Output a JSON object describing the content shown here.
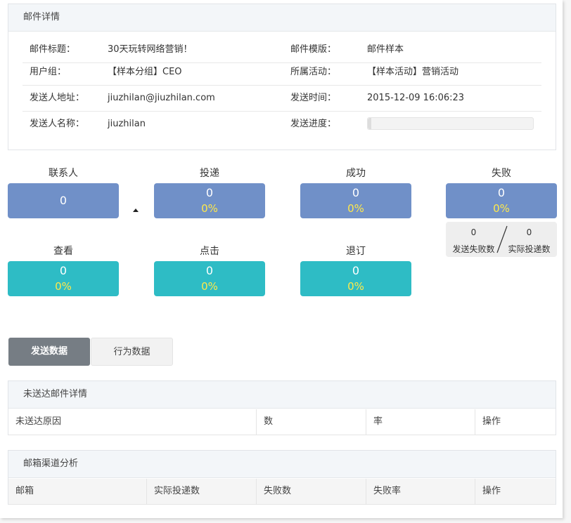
{
  "mail_detail": {
    "title": "邮件详情",
    "rows": [
      {
        "label_a": "邮件标题：",
        "value_a": "30天玩转网络营销！",
        "label_b": "邮件模版：",
        "value_b": "邮件样本"
      },
      {
        "label_a": "用户组：",
        "value_a": "【样本分组】CEO",
        "label_b": "所属活动：",
        "value_b": "【样本活动】营销活动"
      },
      {
        "label_a": "发送人地址：",
        "value_a": "jiuzhilan@jiuzhilan.com",
        "label_b": "发送时间：",
        "value_b": "2015-12-09 16:06:23"
      },
      {
        "label_a": "发送人名称：",
        "value_a": "jiuzhilan",
        "label_b": "发送进度：",
        "value_b": ""
      }
    ],
    "send_progress": 0.02
  },
  "stats": {
    "contacts": {
      "label": "联系人",
      "value": "0"
    },
    "delivered": {
      "label": "投递",
      "value": "0",
      "pct": "0%"
    },
    "success": {
      "label": "成功",
      "value": "0",
      "pct": "0%"
    },
    "failed": {
      "label": "失败",
      "value": "0",
      "pct": "0%"
    },
    "viewed": {
      "label": "查看",
      "value": "0",
      "pct": "0%"
    },
    "clicked": {
      "label": "点击",
      "value": "0",
      "pct": "0%"
    },
    "unsubscribed": {
      "label": "退订",
      "value": "0",
      "pct": "0%"
    },
    "fail_detail": {
      "send_fail_count": "0",
      "send_fail_label": "发送失败数",
      "actual_delivered_count": "0",
      "actual_delivered_label": "实际投递数"
    }
  },
  "tabs": {
    "send_data": "发送数据",
    "behavior_data": "行为数据"
  },
  "undelivered": {
    "title": "未送达邮件详情",
    "columns": [
      "未送达原因",
      "数",
      "率",
      "操作"
    ]
  },
  "mailbox_channel": {
    "title": "邮箱渠道分析",
    "columns": [
      "邮箱",
      "实际投递数",
      "失败数",
      "失败率",
      "操作"
    ]
  },
  "colors": {
    "blue_box": "#7090c8",
    "teal_box": "#2ebcc5",
    "pct_text": "#ffe94a",
    "active_tab": "#767d84"
  }
}
